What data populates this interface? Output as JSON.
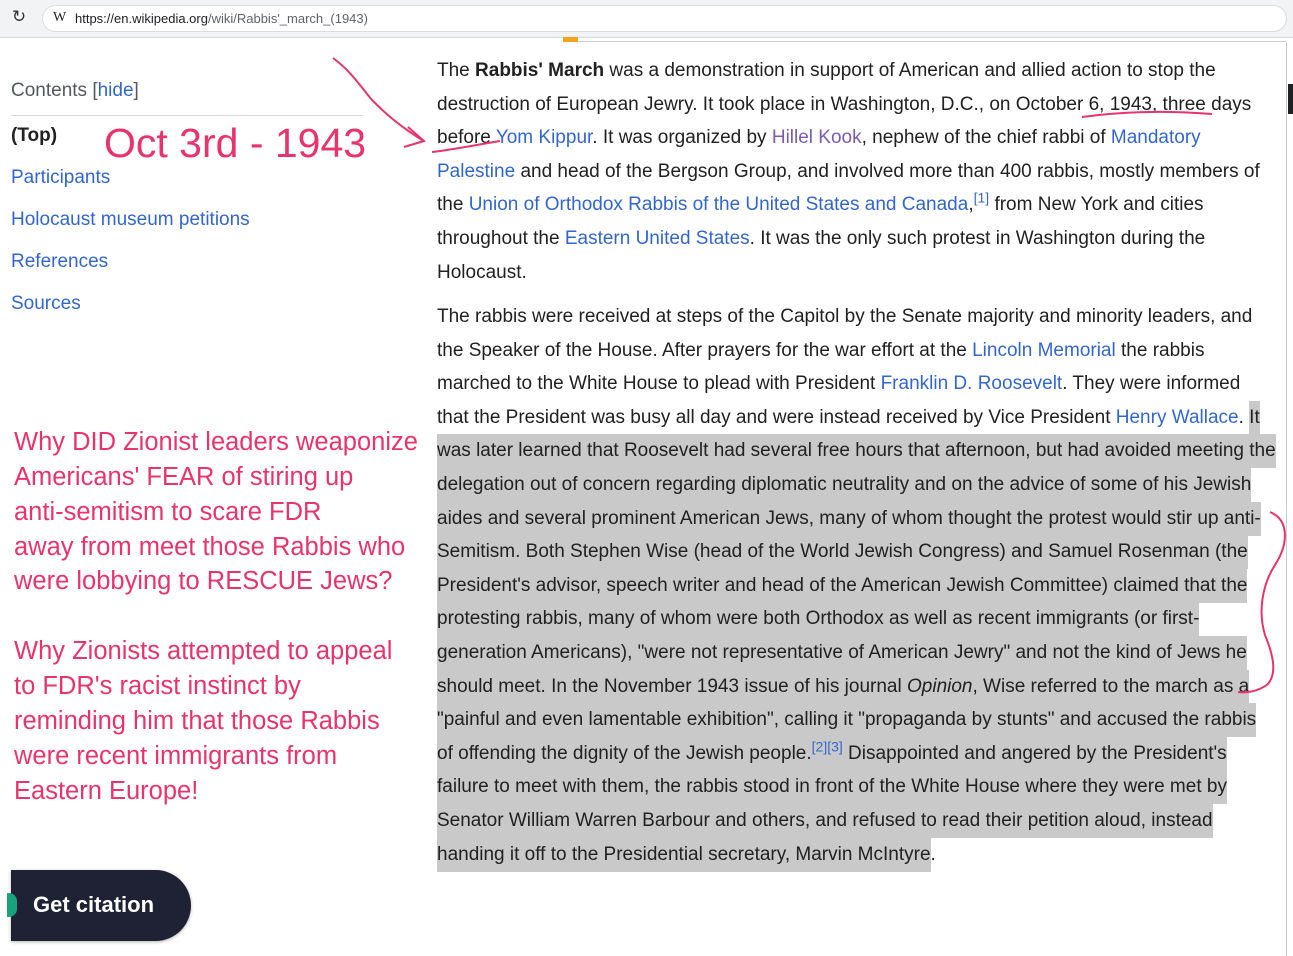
{
  "browser": {
    "favicon": "W",
    "url_host": "https://en.wikipedia.org",
    "url_path": "/wiki/Rabbis'_march_(1943)",
    "reload_icon": "reload-icon"
  },
  "toc": {
    "title": "Contents",
    "hide_open": "[",
    "hide_label": "hide",
    "hide_close": "]",
    "items": [
      "(Top)",
      "Participants",
      "Holocaust museum petitions",
      "References",
      "Sources"
    ]
  },
  "annotations": {
    "date_note": "Oct 3rd - 1943",
    "question1": [
      "Why DID Zionist leaders weaponize",
      "Americans' FEAR of stiring up",
      "anti-semitism to scare FDR",
      "away from meet those Rabbis who",
      "were lobbying to RESCUE Jews?"
    ],
    "question2": [
      "Why Zionists attempted to appeal",
      "to FDR's racist instinct by",
      "reminding him that those Rabbis",
      "were recent immigrants from",
      "Eastern Europe!"
    ],
    "color": "#e8336d"
  },
  "article": {
    "p1": {
      "t1": "The ",
      "bold": "Rabbis' March",
      "t2": " was a demonstration in support of American and allied action to stop the destruction of European Jewry. It took place in Washington, D.C., on October 6, 1943, three days before ",
      "l1": "Yom Kippur",
      "t3": ". It was organized by ",
      "l2": "Hillel Kook",
      "t4": ", nephew of the chief rabbi of ",
      "l3": "Mandatory Palestine",
      "t5": " and head of the Bergson Group, and involved more than 400 rabbis, mostly members of the ",
      "l4": "Union of Orthodox Rabbis of the United States and Canada",
      "t6": ",",
      "ref1": "[1]",
      "t7": " from New York and cities throughout the ",
      "l5": "Eastern United States",
      "t8": ". It was the only such protest in Washington during the Holocaust."
    },
    "p2": {
      "t1": "The rabbis were received at steps of the Capitol by the Senate majority and minority leaders, and the Speaker of the House. After prayers for the war effort at the ",
      "l1": "Lincoln Memorial",
      "t2": " the rabbis marched to the White House to plead with President ",
      "l2": "Franklin D. Roosevelt",
      "t3": ". They were informed that the President was busy all day and were instead received by Vice President ",
      "l3": "Henry Wallace",
      "t4": ". ",
      "h1": "It was later learned that Roosevelt had several free hours that afternoon, but had avoided meeting the delegation out of concern regarding diplomatic neutrality and on the advice of some of his Jewish aides and several prominent American Jews, many of whom thought the protest would stir up anti-Semitism. Both Stephen Wise (head of the World Jewish Congress) and Samuel Rosenman (the President's advisor, speech writer and head of the American Jewish Committee) claimed that the protesting rabbis, many of whom were both Orthodox as well as recent immigrants (or first-generation Americans), \"were not representative of American Jewry\" and not the kind of Jews he should meet. In the November 1943 issue of his journal ",
      "h_italic": "Opinion",
      "h2": ", Wise referred to the march as a \"painful and even lamentable exhibition\", calling it \"propaganda by stunts\" and accused the rabbis of offending the dignity of the Jewish people.",
      "ref2": "[2][3]",
      "h3": " Disappointed and angered by the President's failure to meet with them, the rabbis stood in front of the White House where they were met by Senator William Warren Barbour and others, and refused to read their petition aloud, instead handing it off to the Presidential secretary, Marvin McIntyre",
      "t5": "."
    }
  },
  "citation": {
    "label": "Get citation"
  }
}
